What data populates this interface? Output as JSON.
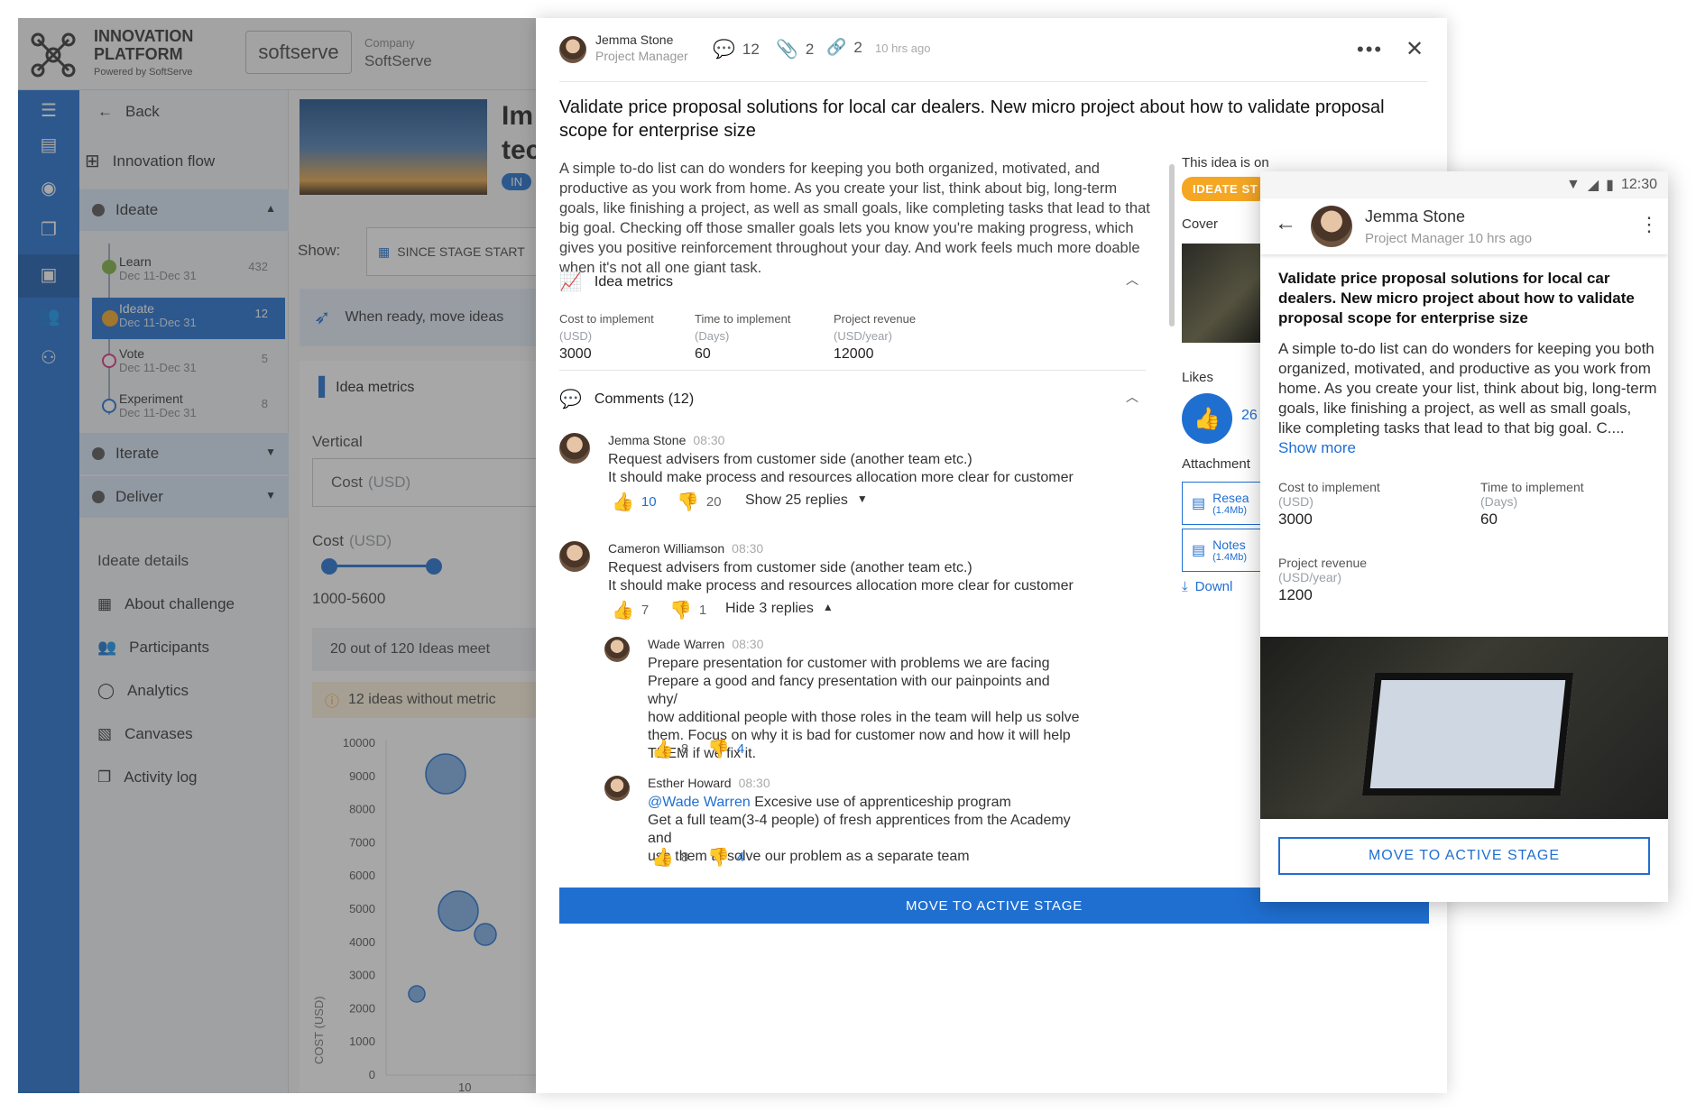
{
  "topbar": {
    "app_title_line1": "INNOVATION",
    "app_title_line2": "PLATFORM",
    "app_powered": "Powered by SoftServe",
    "brand": "softserve",
    "company_label": "Company",
    "company_name": "SoftServe"
  },
  "nav": {
    "back_label": "Back",
    "innovation_flow": "Innovation flow",
    "stages": [
      {
        "label": "Ideate"
      },
      {
        "label": "Iterate"
      },
      {
        "label": "Deliver"
      }
    ],
    "substages": [
      {
        "label": "Learn",
        "dates": "Dec 11-Dec 31",
        "count": "432"
      },
      {
        "label": "Ideate",
        "dates": "Dec 11-Dec 31",
        "count": "12"
      },
      {
        "label": "Vote",
        "dates": "Dec 11-Dec 31",
        "count": "5"
      },
      {
        "label": "Experiment",
        "dates": "Dec 11-Dec 31",
        "count": "8"
      }
    ],
    "details_title": "Ideate details",
    "details": [
      {
        "label": "About challenge",
        "icon": "clipboard-icon"
      },
      {
        "label": "Participants",
        "icon": "people-icon"
      },
      {
        "label": "Analytics",
        "icon": "donut-icon"
      },
      {
        "label": "Canvases",
        "icon": "canvas-icon"
      },
      {
        "label": "Activity log",
        "icon": "log-icon"
      }
    ]
  },
  "mid": {
    "title_fragment_1": "Im",
    "title_fragment_2": "tec",
    "tag_fragment": "IN",
    "show_label": "Show:",
    "show_value": "SINCE STAGE START",
    "hint": "When ready, move ideas",
    "metrics_title": "Idea metrics",
    "vertical_label": "Vertical",
    "vertical_value": "Cost",
    "vertical_unit": "(USD)",
    "cost_label": "Cost",
    "cost_unit": "(USD)",
    "range": "1000-5600",
    "ideas_count": "20 out of 120  Ideas meet",
    "warning": "12 ideas without metric",
    "y_axis_label": "COST (USD)",
    "y_ticks": [
      "10000",
      "9000",
      "8000",
      "7000",
      "6000",
      "5000",
      "4000",
      "3000",
      "2000",
      "1000",
      "0"
    ],
    "x_tick_partial": "10"
  },
  "panel": {
    "author": "Jemma Stone",
    "author_role": "Project Manager",
    "comments_count": "12",
    "attachments_count": "2",
    "links_count": "2",
    "time_ago": "10 hrs ago",
    "title": "Validate price proposal solutions for local car dealers. New micro project about how to validate proposal scope for enterprise size",
    "description": "A simple to-do list can do wonders for keeping you both organized, motivated, and productive as you work from home. As you create your list, think about big, long-term goals, like finishing a project, as well as small goals, like completing tasks that lead to that big goal. Checking off those smaller goals lets you know you're making progress, which gives you positive reinforcement throughout your day. And work feels much more doable when it's not all one giant task.",
    "metrics_title": "Idea metrics",
    "metrics": [
      {
        "label": "Cost to implement",
        "unit": "(USD)",
        "value": "3000"
      },
      {
        "label": "Time to implement",
        "unit": "(Days)",
        "value": "60"
      },
      {
        "label": "Project revenue",
        "unit": "(USD/year)",
        "value": "12000"
      }
    ],
    "comments_title": "Comments (12)",
    "comments": [
      {
        "name": "Jemma Stone",
        "time": "08:30",
        "line1": "Request advisers from customer side (another team etc.)",
        "line2": "It should make process and resources allocation more clear for customer",
        "likes": "10",
        "dislikes": "20",
        "replies": "Show 25 replies"
      },
      {
        "name": "Cameron Williamson",
        "time": "08:30",
        "line1": "Request advisers from customer side (another team etc.)",
        "line2": "It should make process and resources allocation more clear for customer",
        "likes": "7",
        "dislikes": "1",
        "replies": "Hide 3 replies"
      }
    ],
    "replies": [
      {
        "name": "Wade Warren",
        "time": "08:30",
        "lines": [
          "Prepare presentation for customer with problems we are facing",
          "Prepare a good and fancy presentation with our painpoints and why/",
          "how additional people with those roles in the team will help us solve",
          "them. Focus on why it is bad for customer now and how it will help",
          "THEM if we fix it."
        ],
        "likes": "8",
        "dislikes": "4"
      },
      {
        "name": "Esther Howard",
        "time": "08:30",
        "mention": "@Wade Warren",
        "first": " Excesive use of apprenticeship program",
        "lines": [
          "Get a full team(3-4 people) of fresh apprentices from the Academy and",
          "use them to solve our problem as a separate team"
        ],
        "likes": "8",
        "dislikes": "4"
      }
    ],
    "side": {
      "stage_label": "This idea is on",
      "stage_badge": "IDEATE ST",
      "cover_label": "Cover",
      "likes_label": "Likes",
      "likes_count": "26",
      "attachments_label": "Attachment",
      "files": [
        {
          "name": "Resea",
          "size": "(1.4Mb)"
        },
        {
          "name": "Notes",
          "size": "(1.4Mb)"
        }
      ],
      "download": "Downl"
    },
    "move_button": "MOVE TO ACTIVE STAGE"
  },
  "mobile": {
    "clock": "12:30",
    "author": "Jemma Stone",
    "subtitle": "Project Manager 10 hrs ago",
    "title": "Validate price proposal solutions for local car dealers. New micro project about how to validate proposal scope for enterprise size",
    "description": "A simple to-do list can do wonders for keeping you both organized, motivated, and productive as you work from home. As you create your list, think about big, long-term goals, like finishing a project, as well as small goals, like completing tasks that lead to that big goal. C....",
    "show_more": "Show more",
    "metrics": [
      {
        "label": "Cost to implement",
        "unit": "(USD)",
        "value": "3000"
      },
      {
        "label": "Time to implement",
        "unit": "(Days)",
        "value": "60"
      },
      {
        "label": "Project revenue",
        "unit": "(USD/year)",
        "value": "1200"
      }
    ],
    "move_button": "MOVE TO ACTIVE STAGE"
  },
  "colors": {
    "accent": "#1f6fd1",
    "badge": "#f5a623"
  }
}
